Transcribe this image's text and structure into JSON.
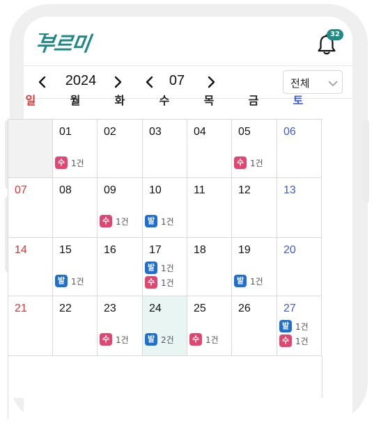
{
  "app": {
    "logo_text": "부르미",
    "notification_count": "32"
  },
  "colors": {
    "brand": "#1f8a83",
    "sunday": "#e03131",
    "saturday": "#3b5bdb",
    "su_chip": "#e0466f",
    "bal_chip": "#1f6fd1",
    "today_bg": "#e8f5f3"
  },
  "controls": {
    "year": "2024",
    "month": "07",
    "filter_label": "전체"
  },
  "weekdays": [
    "일",
    "월",
    "화",
    "수",
    "목",
    "금",
    "토"
  ],
  "weeks": [
    [
      {
        "date": "",
        "tags": []
      },
      {
        "date": "01",
        "tags": [
          {
            "type": "수",
            "count": "1건"
          }
        ]
      },
      {
        "date": "02",
        "tags": []
      },
      {
        "date": "03",
        "tags": []
      },
      {
        "date": "04",
        "tags": []
      },
      {
        "date": "05",
        "tags": [
          {
            "type": "수",
            "count": "1건"
          }
        ]
      },
      {
        "date": "06",
        "tags": []
      }
    ],
    [
      {
        "date": "07",
        "tags": []
      },
      {
        "date": "08",
        "tags": []
      },
      {
        "date": "09",
        "tags": [
          {
            "type": "수",
            "count": "1건"
          }
        ]
      },
      {
        "date": "10",
        "tags": [
          {
            "type": "발",
            "count": "1건"
          }
        ]
      },
      {
        "date": "11",
        "tags": []
      },
      {
        "date": "12",
        "tags": []
      },
      {
        "date": "13",
        "tags": []
      }
    ],
    [
      {
        "date": "14",
        "tags": []
      },
      {
        "date": "15",
        "tags": [
          {
            "type": "발",
            "count": "1건"
          }
        ]
      },
      {
        "date": "16",
        "tags": []
      },
      {
        "date": "17",
        "tags": [
          {
            "type": "발",
            "count": "1건"
          },
          {
            "type": "수",
            "count": "1건"
          }
        ]
      },
      {
        "date": "18",
        "tags": []
      },
      {
        "date": "19",
        "tags": [
          {
            "type": "발",
            "count": "1건"
          }
        ]
      },
      {
        "date": "20",
        "tags": []
      }
    ],
    [
      {
        "date": "21",
        "tags": []
      },
      {
        "date": "22",
        "tags": []
      },
      {
        "date": "23",
        "tags": [
          {
            "type": "수",
            "count": "1건"
          }
        ]
      },
      {
        "date": "24",
        "today": true,
        "tags": [
          {
            "type": "발",
            "count": "2건"
          }
        ]
      },
      {
        "date": "25",
        "tags": [
          {
            "type": "수",
            "count": "1건"
          }
        ]
      },
      {
        "date": "26",
        "tags": []
      },
      {
        "date": "27",
        "tags": [
          {
            "type": "발",
            "count": "1건"
          },
          {
            "type": "수",
            "count": "1건"
          }
        ]
      }
    ]
  ]
}
